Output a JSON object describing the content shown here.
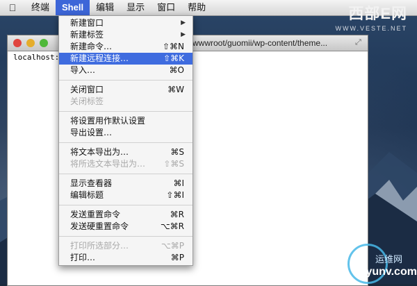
{
  "menubar": {
    "items": [
      "终端",
      "Shell",
      "编辑",
      "显示",
      "窗口",
      "帮助"
    ],
    "active": "Shell"
  },
  "brand": {
    "name": "西部E网",
    "url": "WWW.VESTE.NET"
  },
  "terminal": {
    "title_path": "wwwroot/guomii/wp-content/theme...",
    "prompt": "localhost:"
  },
  "shell_menu": {
    "items": [
      {
        "label": "新建窗口",
        "shortcut": "",
        "submenu": true,
        "state": "normal"
      },
      {
        "label": "新建标签",
        "shortcut": "",
        "submenu": true,
        "state": "normal"
      },
      {
        "label": "新建命令…",
        "shortcut": "⇧⌘N",
        "submenu": false,
        "state": "normal"
      },
      {
        "label": "新建远程连接…",
        "shortcut": "⇧⌘K",
        "submenu": false,
        "state": "highlighted"
      },
      {
        "label": "导入…",
        "shortcut": "⌘O",
        "submenu": false,
        "state": "normal"
      },
      {
        "label": "关闭窗口",
        "shortcut": "⌘W",
        "submenu": false,
        "state": "normal"
      },
      {
        "label": "关闭标签",
        "shortcut": "",
        "submenu": false,
        "state": "disabled"
      },
      {
        "label": "将设置用作默认设置",
        "shortcut": "",
        "submenu": false,
        "state": "normal"
      },
      {
        "label": "导出设置…",
        "shortcut": "",
        "submenu": false,
        "state": "normal"
      },
      {
        "label": "将文本导出为…",
        "shortcut": "⌘S",
        "submenu": false,
        "state": "normal"
      },
      {
        "label": "将所选文本导出为…",
        "shortcut": "⇧⌘S",
        "submenu": false,
        "state": "disabled"
      },
      {
        "label": "显示查看器",
        "shortcut": "⌘I",
        "submenu": false,
        "state": "normal"
      },
      {
        "label": "编辑标题",
        "shortcut": "⇧⌘I",
        "submenu": false,
        "state": "normal"
      },
      {
        "label": "发送重置命令",
        "shortcut": "⌘R",
        "submenu": false,
        "state": "normal"
      },
      {
        "label": "发送硬重置命令",
        "shortcut": "⌥⌘R",
        "submenu": false,
        "state": "normal"
      },
      {
        "label": "打印所选部分…",
        "shortcut": "⌥⌘P",
        "submenu": false,
        "state": "disabled"
      },
      {
        "label": "打印…",
        "shortcut": "⌘P",
        "submenu": false,
        "state": "normal"
      }
    ]
  },
  "watermark": {
    "line1": "运维网",
    "line2": "iyunv.com"
  },
  "colors": {
    "highlight": "#3f6cdf",
    "menubar_active": "#3d66d8"
  }
}
